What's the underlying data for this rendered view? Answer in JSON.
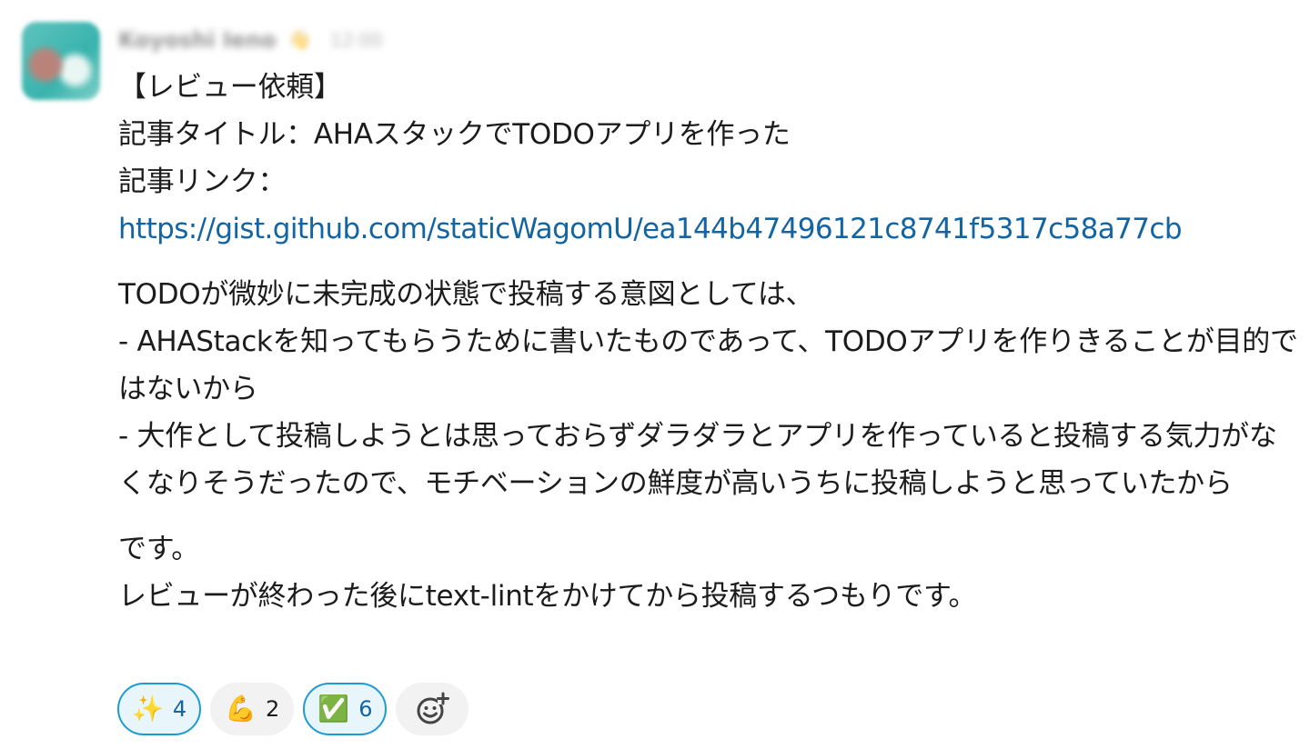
{
  "message": {
    "sender": "Koyoshi Ieno",
    "status_emoji": "👋",
    "timestamp": "12:00",
    "lines": {
      "l1": "【レビュー依頼】",
      "l2": "記事タイトル：AHAスタックでTODOアプリを作った",
      "l3": "記事リンク：",
      "link": "https://gist.github.com/staticWagomU/ea144b47496121c8741f5317c58a77cb",
      "p2_l1": "TODOが微妙に未完成の状態で投稿する意図としては、",
      "p2_l2": "- AHAStackを知ってもらうために書いたものであって、TODOアプリを作りきることが目的ではないから",
      "p2_l3": "- 大作として投稿しようとは思っておらずダラダラとアプリを作っていると投稿する気力がなくなりそうだったので、モチベーションの鮮度が高いうちに投稿しようと思っていたから",
      "p3_l1": "です。",
      "p3_l2": "レビューが終わった後にtext-lintをかけてから投稿するつもりです。"
    }
  },
  "reactions": [
    {
      "emoji": "✨",
      "count": "4",
      "active": true
    },
    {
      "emoji": "💪",
      "count": "2",
      "active": false
    },
    {
      "emoji": "✅",
      "count": "6",
      "active": true
    }
  ],
  "add_reaction_icon": "add-emoji-icon",
  "colors": {
    "link": "#1264a3",
    "active_border": "#1d9bd1",
    "active_bg": "#e8f5fa",
    "chip_bg": "#f2f2f2"
  }
}
